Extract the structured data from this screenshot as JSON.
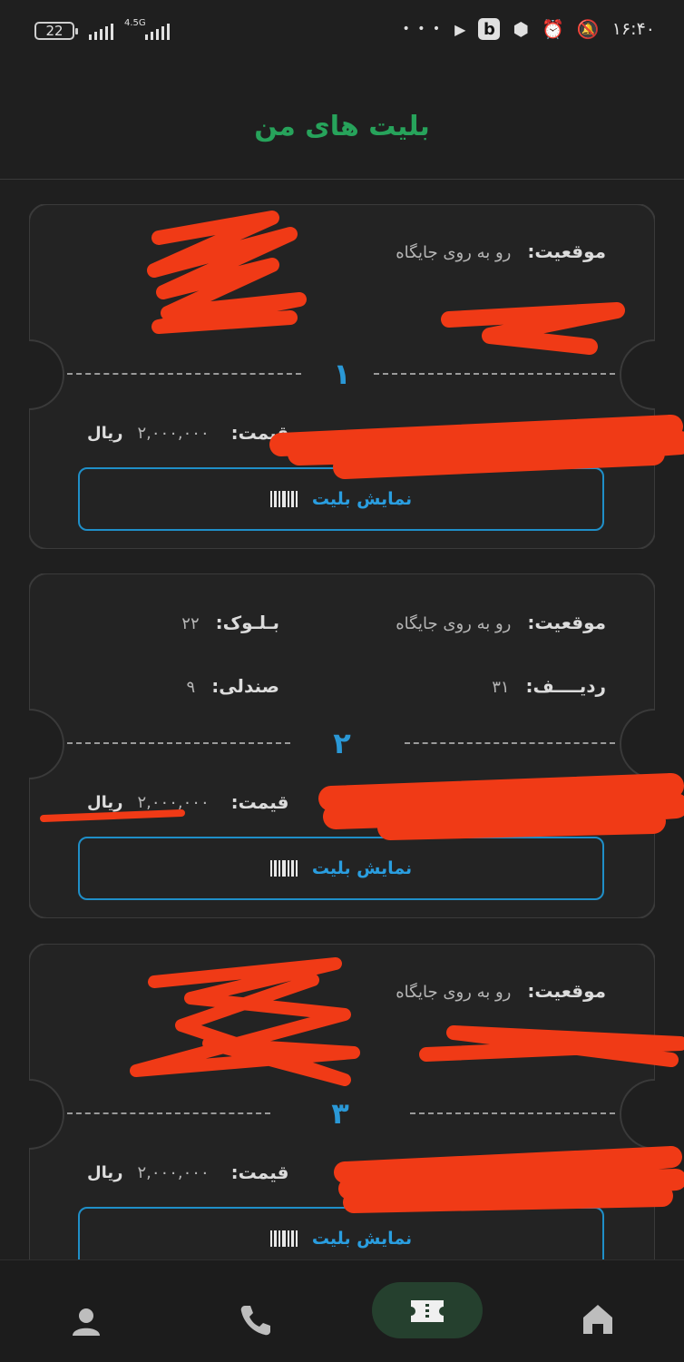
{
  "status_bar": {
    "battery": "22",
    "network": "4.5G",
    "time": "۱۶:۴۰",
    "overflow": "• • •",
    "b_icon_letter": "b"
  },
  "header": {
    "title": "بلیت های من"
  },
  "tickets": [
    {
      "number": "۱",
      "location_label": "موقعیت:",
      "location_value": "رو به روی جایگاه",
      "price_label": "قیمت:",
      "price_value": "۲,۰۰۰,۰۰۰",
      "currency": "ریال",
      "show_button": "نمایش بلیت"
    },
    {
      "number": "۲",
      "location_label": "موقعیت:",
      "location_value": "رو به روی جایگاه",
      "block_label": "بـلـوک:",
      "block_value": "۲۲",
      "row_label": "ردیــــف:",
      "row_value": "۳۱",
      "seat_label": "صندلی:",
      "seat_value": "۹",
      "price_label": "قیمت:",
      "price_value": "۲,۰۰۰,۰۰۰",
      "currency": "ریال",
      "show_button": "نمایش بلیت"
    },
    {
      "number": "۳",
      "location_label": "موقعیت:",
      "location_value": "رو به روی جایگاه",
      "price_label": "قیمت:",
      "price_value": "۲,۰۰۰,۰۰۰",
      "currency": "ریال",
      "show_button": "نمایش بلیت"
    }
  ],
  "bottom_nav": {
    "items": [
      "profile-icon",
      "phone-icon",
      "ticket-icon",
      "home-icon"
    ],
    "active": "ticket-icon"
  },
  "colors": {
    "background": "#1f1f1f",
    "title_green": "#27a35b",
    "accent_blue": "#2a98d6",
    "redaction": "#f03a16",
    "nav_active": "#25402e"
  }
}
